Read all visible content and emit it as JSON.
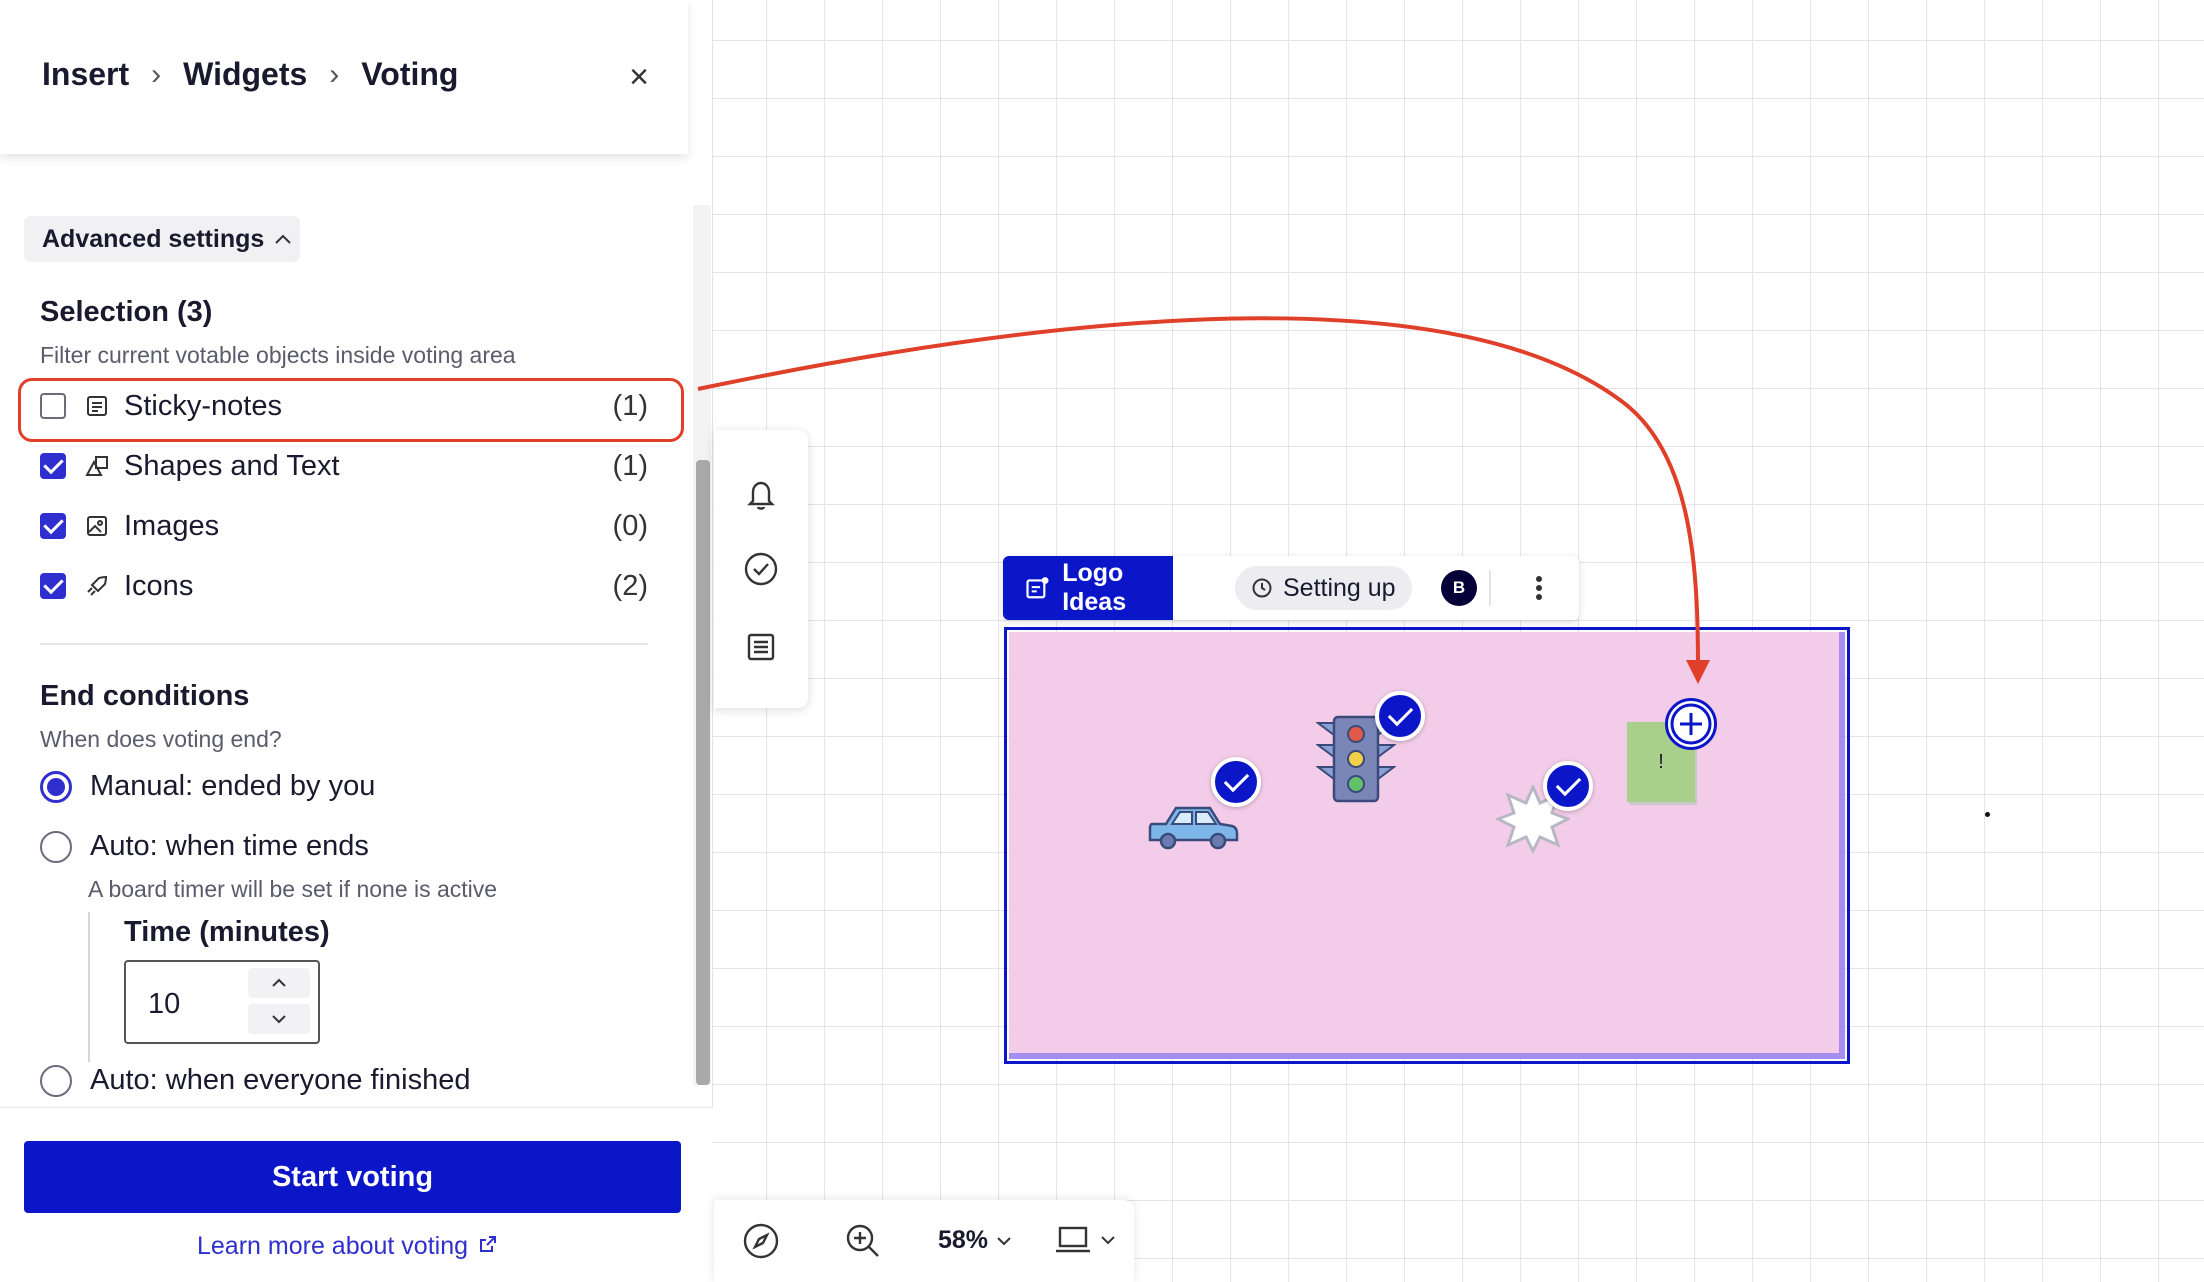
{
  "breadcrumb": {
    "items": [
      "Insert",
      "Widgets",
      "Voting"
    ]
  },
  "close_symbol": "×",
  "advanced_settings": {
    "label": "Advanced settings"
  },
  "selection": {
    "title": "Selection (3)",
    "subtitle": "Filter current votable objects inside voting area",
    "filters": [
      {
        "label": "Sticky-notes",
        "count": "(1)",
        "checked": false,
        "icon": "sticky-note-icon"
      },
      {
        "label": "Shapes and Text",
        "count": "(1)",
        "checked": true,
        "icon": "shapes-icon"
      },
      {
        "label": "Images",
        "count": "(0)",
        "checked": true,
        "icon": "image-icon"
      },
      {
        "label": "Icons",
        "count": "(2)",
        "checked": true,
        "icon": "rocket-icon"
      }
    ]
  },
  "end_conditions": {
    "title": "End conditions",
    "subtitle": "When does voting end?",
    "options": [
      {
        "label": "Manual: ended by you",
        "selected": true
      },
      {
        "label": "Auto: when time ends",
        "selected": false,
        "hint": "A board timer will be set if none is active"
      },
      {
        "label": "Auto: when everyone finished",
        "selected": false
      }
    ],
    "time": {
      "label": "Time (minutes)",
      "value": "10"
    }
  },
  "footer": {
    "start_label": "Start voting",
    "learn_label": "Learn more about voting"
  },
  "frame": {
    "tag_label": "Logo Ideas",
    "status_label": "Setting up",
    "avatar_initial": "B",
    "sticky_text": "!"
  },
  "bottom_toolbar": {
    "zoom_label": "58%"
  },
  "colors": {
    "accent": "#0b16c9",
    "highlight": "#e0402a",
    "frame_fill": "#f2cce8",
    "sticky": "#a8d08a"
  }
}
